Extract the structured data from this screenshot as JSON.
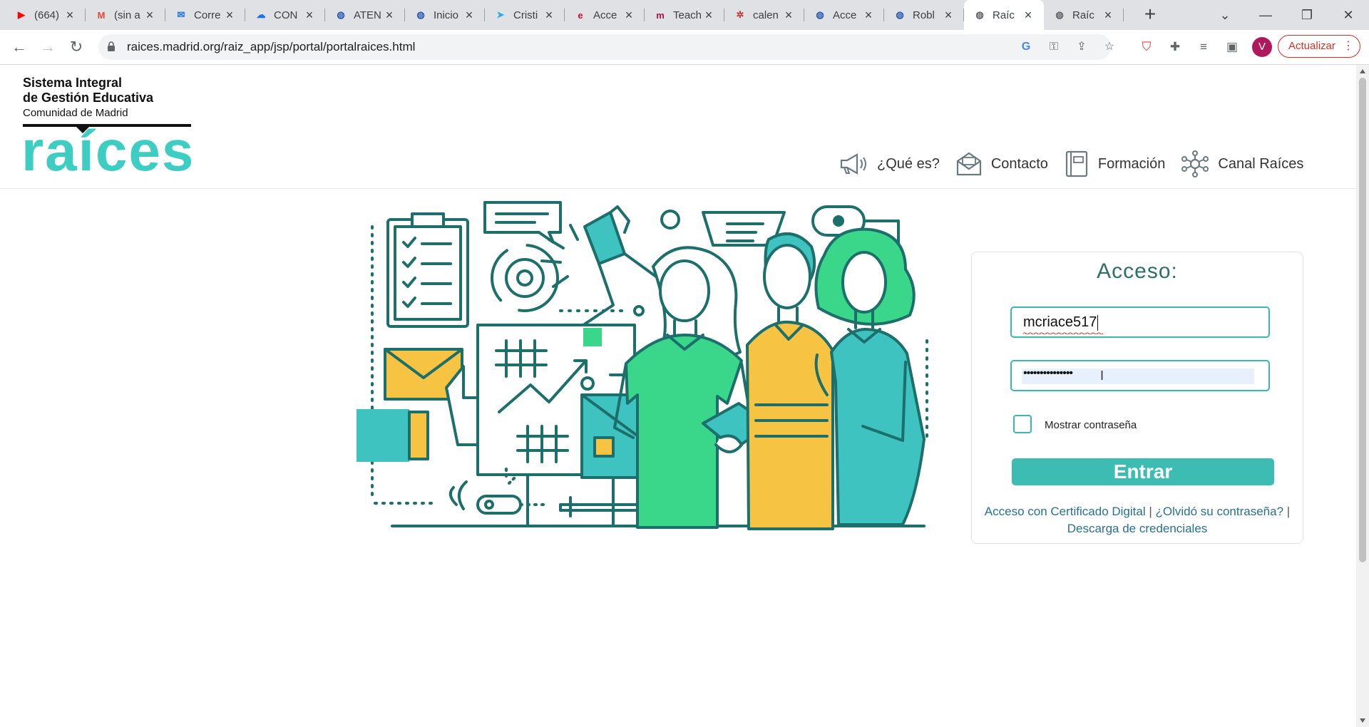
{
  "browser": {
    "tabs": [
      {
        "title": "(664)",
        "favicon": "youtube-icon",
        "color": "#ff0000"
      },
      {
        "title": "(sin a",
        "favicon": "gmail-icon",
        "color": "#ea4335"
      },
      {
        "title": "Corre",
        "favicon": "mail-icon",
        "color": "#1a73e8"
      },
      {
        "title": "CON",
        "favicon": "cloud-icon",
        "color": "#1a73e8"
      },
      {
        "title": "ATEN",
        "favicon": "globe-icon",
        "color": "#2a5db0"
      },
      {
        "title": "Inicio",
        "favicon": "globe-icon",
        "color": "#2a5db0"
      },
      {
        "title": "Cristi",
        "favicon": "telegram-icon",
        "color": "#2aabee"
      },
      {
        "title": "Acce",
        "favicon": "e-icon",
        "color": "#c4122f"
      },
      {
        "title": "Teach",
        "favicon": "m-icon",
        "color": "#b3143d"
      },
      {
        "title": "calen",
        "favicon": "gear-icon",
        "color": "#c53929"
      },
      {
        "title": "Acce",
        "favicon": "globe-icon",
        "color": "#2a5db0"
      },
      {
        "title": "Robl",
        "favicon": "globe-icon",
        "color": "#2a5db0"
      },
      {
        "title": "Raíc",
        "favicon": "globe-icon",
        "color": "#5f6368",
        "active": true
      },
      {
        "title": "Raíc",
        "favicon": "globe-icon",
        "color": "#5f6368"
      }
    ],
    "url": "raices.madrid.org/raiz_app/jsp/portal/portalraices.html",
    "profile_initial": "V",
    "update_label": "Actualizar"
  },
  "header": {
    "brand_line1": "Sistema Integral",
    "brand_line2": "de Gestión Educativa",
    "brand_line3": "Comunidad de Madrid",
    "brand_word": "raíces",
    "nav": [
      {
        "label": "¿Qué es?",
        "icon": "megaphone-icon"
      },
      {
        "label": "Contacto",
        "icon": "envelope-icon"
      },
      {
        "label": "Formación",
        "icon": "book-icon"
      },
      {
        "label": "Canal Raíces",
        "icon": "network-icon"
      }
    ]
  },
  "login": {
    "title": "Acceso:",
    "username": "mcriace517",
    "password_mask": "•••••••••••••••",
    "show_password_label": "Mostrar contraseña",
    "submit_label": "Entrar",
    "link_certificate": "Acceso con Certificado Digital",
    "link_forgot": "¿Olvidó su contraseña?",
    "link_credentials": "Descarga de credenciales"
  },
  "colors": {
    "brand_teal": "#3dcdc2",
    "button_teal": "#3dbcb4",
    "accent_green": "#3ad68a",
    "accent_yellow": "#f6c343",
    "line_dark": "#1d6f6b"
  }
}
